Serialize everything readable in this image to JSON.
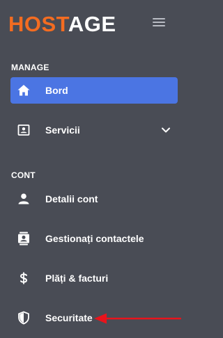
{
  "brand": {
    "part1": "HOST",
    "part2": "AGE"
  },
  "sections": [
    {
      "title": "MANAGE"
    },
    {
      "title": "CONT"
    }
  ],
  "manage_items": [
    {
      "label": "Bord",
      "icon": "home-icon",
      "active": true
    },
    {
      "label": "Servicii",
      "icon": "services-icon",
      "has_submenu": true
    }
  ],
  "account_items": [
    {
      "label": "Detalii cont",
      "icon": "user-icon"
    },
    {
      "label": "Gestionați contactele",
      "icon": "contacts-icon"
    },
    {
      "label": "Plăți & facturi",
      "icon": "dollar-icon"
    },
    {
      "label": "Securitate",
      "icon": "shield-icon"
    }
  ],
  "colors": {
    "background": "#494c55",
    "accent": "#4b75e3",
    "brand_orange": "#f36c21",
    "annotation_arrow": "#e8141c"
  }
}
